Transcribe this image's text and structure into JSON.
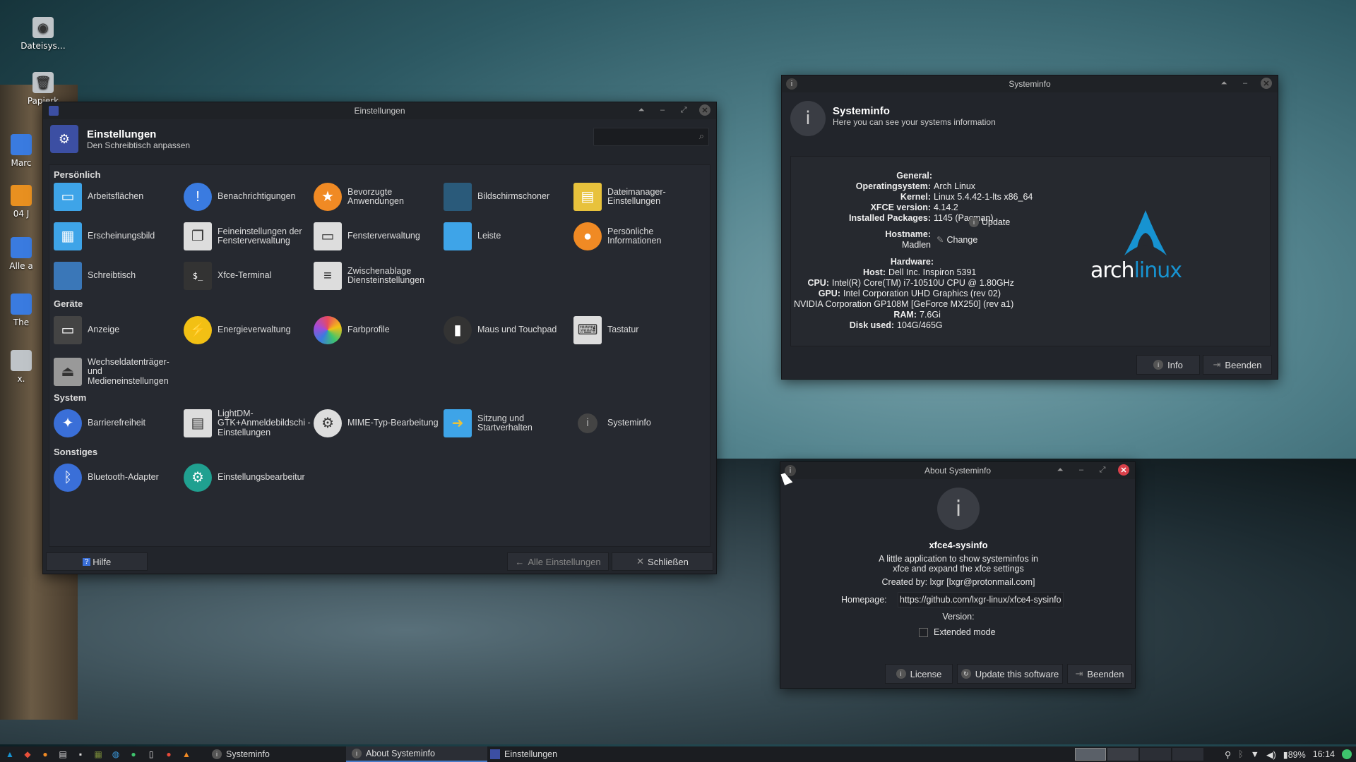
{
  "desktop": {
    "icons": [
      {
        "label": "Dateisys…",
        "icon": "harddisk-icon"
      },
      {
        "label": "Papierk",
        "icon": "trash-icon"
      },
      {
        "label": "Marc",
        "icon": "folder-icon"
      },
      {
        "label": "04 J",
        "icon": "folder-icon"
      },
      {
        "label": "Alle a",
        "icon": "file-icon"
      },
      {
        "label": "The",
        "icon": "file-icon"
      },
      {
        "label": "x.",
        "icon": "file-icon"
      }
    ]
  },
  "settings": {
    "window_title": "Einstellungen",
    "title": "Einstellungen",
    "subtitle": "Den Schreibtisch anpassen",
    "search_placeholder": "",
    "sections": [
      {
        "name": "Persönlich",
        "items": [
          {
            "label": "Arbeitsflächen",
            "icon": "workspaces-icon",
            "color": "#3ea4e8"
          },
          {
            "label": "Benachrichtigungen",
            "icon": "notification-icon",
            "color": "#3a7be0"
          },
          {
            "label": "Bevorzugte Anwendungen",
            "icon": "star-icon",
            "color": "#f08a24"
          },
          {
            "label": "Bildschirmschoner",
            "icon": "screensaver-icon",
            "color": "#2a5a7a"
          },
          {
            "label": "Dateimanager-Einstellungen",
            "icon": "file-manager-icon",
            "color": "#e8c23c"
          },
          {
            "label": "Erscheinungsbild",
            "icon": "appearance-icon",
            "color": "#3ea4e8"
          },
          {
            "label": "Feineinstellungen der Fensterverwaltung",
            "icon": "window-tweaks-icon",
            "color": "#dddddd"
          },
          {
            "label": "Fensterverwaltung",
            "icon": "window-manager-icon",
            "color": "#dddddd"
          },
          {
            "label": "Leiste",
            "icon": "panel-icon",
            "color": "#3ea4e8"
          },
          {
            "label": "Persönliche Informationen",
            "icon": "user-icon",
            "color": "#f08a24"
          },
          {
            "label": "Schreibtisch",
            "icon": "desktop-icon",
            "color": "#3a77b8"
          },
          {
            "label": "Xfce-Terminal",
            "icon": "terminal-icon",
            "color": "#333333"
          },
          {
            "label": "Zwischenablage Diensteinstellungen",
            "icon": "clipboard-icon",
            "color": "#dddddd"
          }
        ]
      },
      {
        "name": "Geräte",
        "items": [
          {
            "label": "Anzeige",
            "icon": "display-icon",
            "color": "#444444"
          },
          {
            "label": "Energieverwaltung",
            "icon": "power-icon",
            "color": "#f2c014"
          },
          {
            "label": "Farbprofile",
            "icon": "color-icon",
            "color": "#e84a5f"
          },
          {
            "label": "Maus und Touchpad",
            "icon": "mouse-icon",
            "color": "#333333"
          },
          {
            "label": "Tastatur",
            "icon": "keyboard-icon",
            "color": "#dddddd"
          },
          {
            "label": "Wechseldatenträger- und Medieneinstellungen",
            "icon": "eject-icon",
            "color": "#999999"
          }
        ]
      },
      {
        "name": "System",
        "items": [
          {
            "label": "Barrierefreiheit",
            "icon": "accessibility-icon",
            "color": "#3a6fd8"
          },
          {
            "label": "LightDM-GTK+Anmeldebildschi - Einstellungen",
            "icon": "login-screen-icon",
            "color": "#dddddd"
          },
          {
            "label": "MIME-Typ-Bearbeitung",
            "icon": "gear-icon",
            "color": "#dddddd"
          },
          {
            "label": "Sitzung und Startverhalten",
            "icon": "session-icon",
            "color": "#3ea4e8"
          },
          {
            "label": "Systeminfo",
            "icon": "info-icon",
            "color": "#444444"
          }
        ]
      },
      {
        "name": "Sonstiges",
        "items": [
          {
            "label": "Bluetooth-Adapter",
            "icon": "bluetooth-icon",
            "color": "#3a6fd8"
          },
          {
            "label": "Einstellungsbearbeitur",
            "icon": "settings-editor-icon",
            "color": "#20a090"
          }
        ]
      }
    ],
    "footer": {
      "help": "Hilfe",
      "all_settings": "Alle Einstellungen",
      "close": "Schließen"
    }
  },
  "sysinfo": {
    "window_title": "Systeminfo",
    "title": "Systeminfo",
    "subtitle": "Here you can see your systems information",
    "general_heading": "General:",
    "os_label": "Operatingsystem:",
    "os_value": "Arch Linux",
    "kernel_label": "Kernel:",
    "kernel_value": "Linux 5.4.42-1-lts x86_64",
    "xfce_label": "XFCE version:",
    "xfce_value": "4.14.2",
    "packages_label": "Installed Packages:",
    "packages_value": "1145 (Pacman)",
    "update_btn": "Update",
    "hostname_label": "Hostname:",
    "hostname_value": "Madlen",
    "change_btn": "Change",
    "hardware_heading": "Hardware:",
    "host_label": "Host:",
    "host_value": "Dell Inc. Inspiron 5391",
    "cpu_label": "CPU:",
    "cpu_value": "Intel(R) Core(TM) i7-10510U CPU @ 1.80GHz",
    "gpu_label": "GPU:",
    "gpu_value": "Intel Corporation UHD Graphics (rev 02)",
    "gpu2_value": "NVIDIA Corporation GP108M [GeForce MX250] (rev a1)",
    "ram_label": "RAM:",
    "ram_value": "7.6Gi",
    "disk_label": "Disk used:",
    "disk_value": "104G/465G",
    "logo_arch": "arch",
    "logo_linux": "linux",
    "info_btn": "Info",
    "quit_btn": "Beenden"
  },
  "about": {
    "window_title": "About Systeminfo",
    "app_name": "xfce4-sysinfo",
    "desc1": "A little application to show systeminfos in",
    "desc2": "xfce and expand the xfce settings",
    "created": "Created by: lxgr [lxgr@protonmail.com]",
    "homepage_label": "Homepage:",
    "homepage_value": "https://github.com/lxgr-linux/xfce4-sysinfo",
    "version_label": "Version:",
    "extended_label": "Extended mode",
    "extended_checked": false,
    "license_btn": "License",
    "update_btn": "Update this software",
    "quit_btn": "Beenden"
  },
  "taskbar": {
    "tasks": [
      {
        "label": "Systeminfo",
        "active": false
      },
      {
        "label": "About Systeminfo",
        "active": true
      },
      {
        "label": "Einstellungen",
        "active": false
      }
    ],
    "battery": "89%",
    "clock": "16:14"
  }
}
